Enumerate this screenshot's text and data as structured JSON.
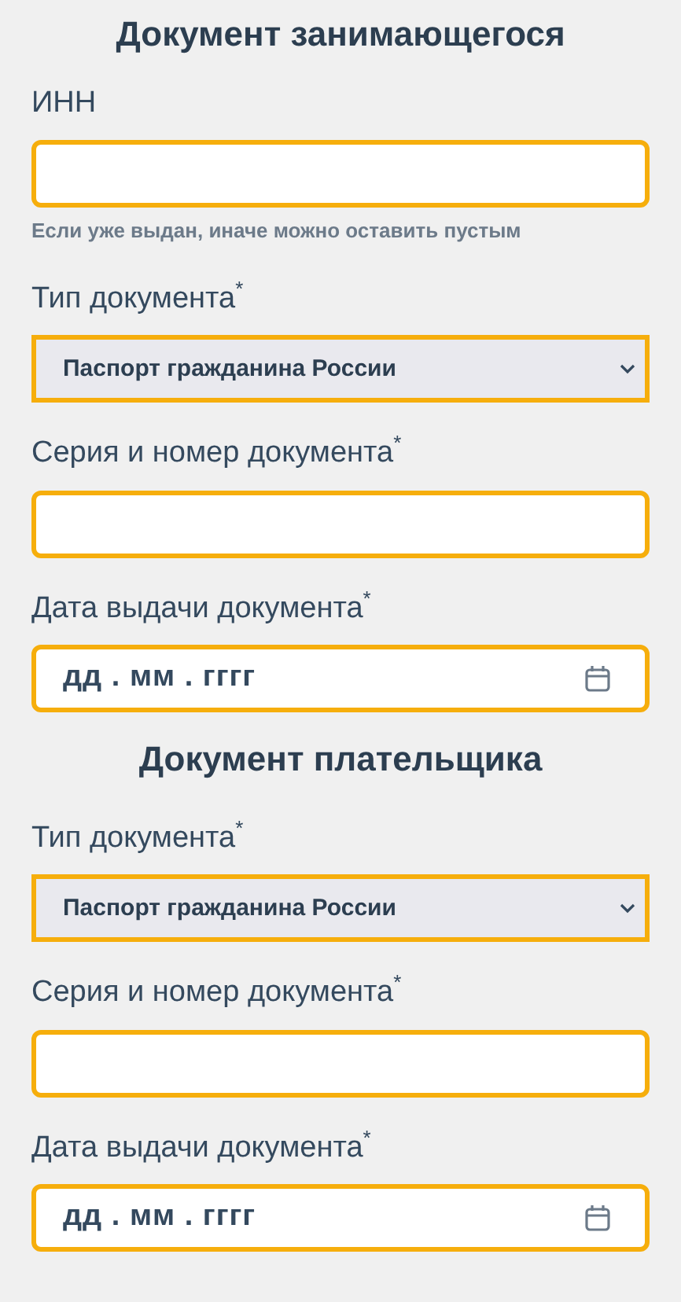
{
  "sections": [
    {
      "title": "Документ занимающегося",
      "fields": [
        {
          "kind": "text",
          "label": "ИНН",
          "hint": "Если уже выдан, иначе можно оставить пустым"
        },
        {
          "kind": "select",
          "label": "Тип документа$^{*}$",
          "value": "Паспорт гражданина России"
        },
        {
          "kind": "text",
          "label": "Серия и номер документа$^{*}$"
        },
        {
          "kind": "date",
          "label": "Дата выдачи документа$^{*}$",
          "placeholder": "дд . мм . гггг"
        }
      ]
    },
    {
      "title": "Документ плательщика",
      "fields": [
        {
          "kind": "select",
          "label": "Тип документа$^{*}$",
          "value": "Паспорт гражданина России"
        },
        {
          "kind": "text",
          "label": "Серия и номер документа$^{*}$"
        },
        {
          "kind": "date",
          "label": "Дата выдачи документа$^{*}$",
          "placeholder": "дд . мм . гггг"
        }
      ]
    }
  ]
}
